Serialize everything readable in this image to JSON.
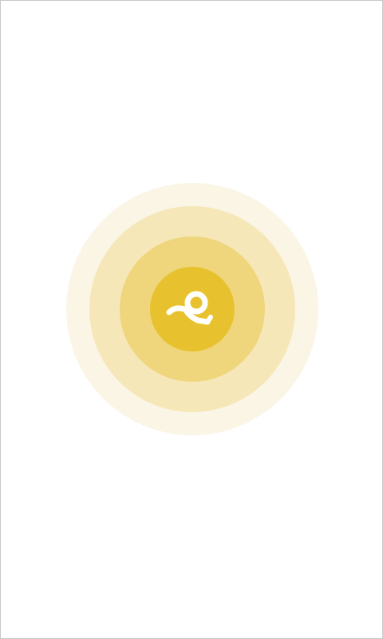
{
  "splash": {
    "logo_icon": "runner-logo-icon",
    "colors": {
      "background": "#ffffff",
      "ring_outer": "#fbf5e6",
      "ring_third": "#f6e7b9",
      "ring_second": "#efd67c",
      "ring_inner": "#e8c22e",
      "logo": "#ffffff"
    }
  }
}
